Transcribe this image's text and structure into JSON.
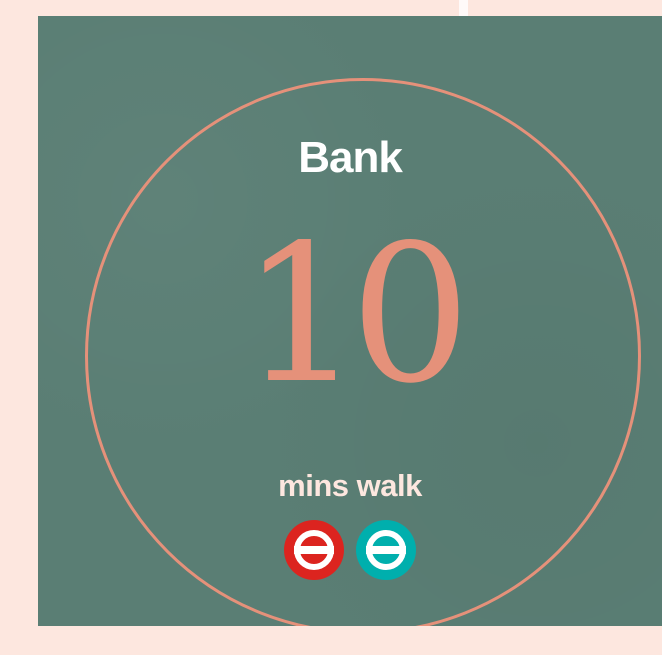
{
  "card": {
    "station": "Bank",
    "walk_minutes": "10",
    "walk_unit": "mins walk",
    "colors": {
      "background_page": "#fde7df",
      "card": "#5a7e74",
      "accent": "#e5917a",
      "text_primary": "#ffffff"
    }
  },
  "lines": [
    {
      "name": "underground-roundel-icon",
      "color": "#dc241f"
    },
    {
      "name": "dlr-roundel-icon",
      "color": "#00afad"
    }
  ]
}
